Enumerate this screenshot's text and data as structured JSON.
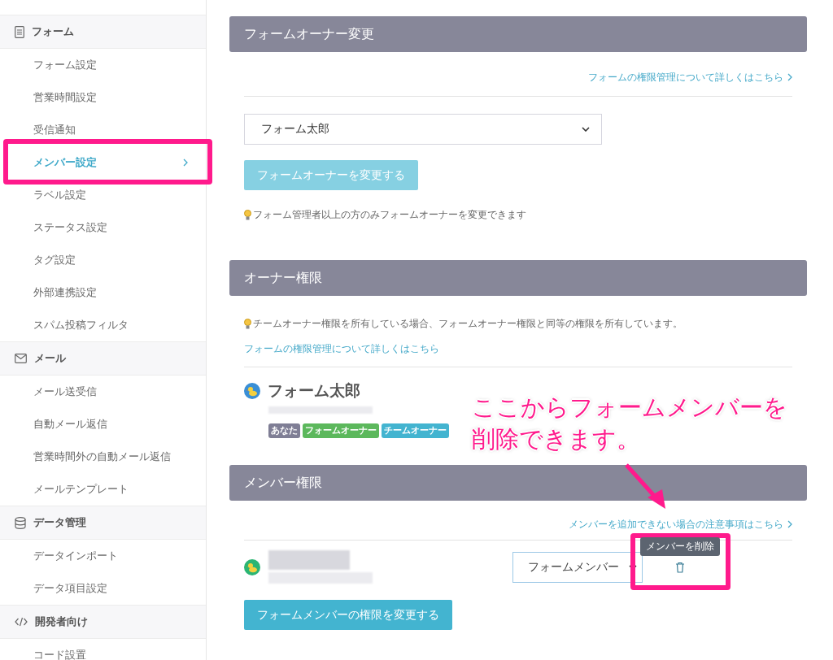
{
  "sidebar": {
    "groups": [
      {
        "label": "フォーム",
        "kind": "form",
        "items": [
          {
            "label": "フォーム設定",
            "selected": false
          },
          {
            "label": "営業時間設定",
            "selected": false
          },
          {
            "label": "受信通知",
            "selected": false
          },
          {
            "label": "メンバー設定",
            "selected": true
          },
          {
            "label": "ラベル設定",
            "selected": false
          },
          {
            "label": "ステータス設定",
            "selected": false
          },
          {
            "label": "タグ設定",
            "selected": false
          },
          {
            "label": "外部連携設定",
            "selected": false
          },
          {
            "label": "スパム投稿フィルタ",
            "selected": false
          }
        ]
      },
      {
        "label": "メール",
        "kind": "mail",
        "items": [
          {
            "label": "メール送受信",
            "selected": false
          },
          {
            "label": "自動メール返信",
            "selected": false
          },
          {
            "label": "営業時間外の自動メール返信",
            "selected": false
          },
          {
            "label": "メールテンプレート",
            "selected": false
          }
        ]
      },
      {
        "label": "データ管理",
        "kind": "database",
        "items": [
          {
            "label": "データインポート",
            "selected": false
          },
          {
            "label": "データ項目設定",
            "selected": false
          }
        ]
      },
      {
        "label": "開発者向け",
        "kind": "code",
        "items": [
          {
            "label": "コード設置",
            "selected": false
          }
        ]
      }
    ]
  },
  "owner_change": {
    "title": "フォームオーナー変更",
    "link": "フォームの権限管理について詳しくはこちら",
    "select": "フォーム太郎",
    "button": {
      "label": "フォームオーナーを変更する",
      "disabled": true
    },
    "note": "フォーム管理者以上の方のみフォームオーナーを変更できます"
  },
  "owner_permission": {
    "title": "オーナー権限",
    "note": "チームオーナー権限を所有している場合、フォームオーナー権限と同等の権限を所有しています。",
    "link": "フォームの権限管理について詳しくはこちら",
    "owner": {
      "name": "フォーム太郎",
      "badges": [
        {
          "label": "あなた",
          "color": "#7f7e95"
        },
        {
          "label": "フォームオーナー",
          "color": "#5cb85c"
        },
        {
          "label": "チームオーナー",
          "color": "#43b4d0"
        }
      ]
    }
  },
  "member_permission": {
    "title": "メンバー権限",
    "link": "メンバーを追加できない場合の注意事項はこちら",
    "member": {
      "role": "フォームメンバー",
      "tooltip": "メンバーを削除"
    },
    "button": {
      "label": "フォームメンバーの権限を変更する",
      "disabled": false
    }
  },
  "annotation": {
    "text": "ここからフォームメンバーを削除できます。"
  }
}
